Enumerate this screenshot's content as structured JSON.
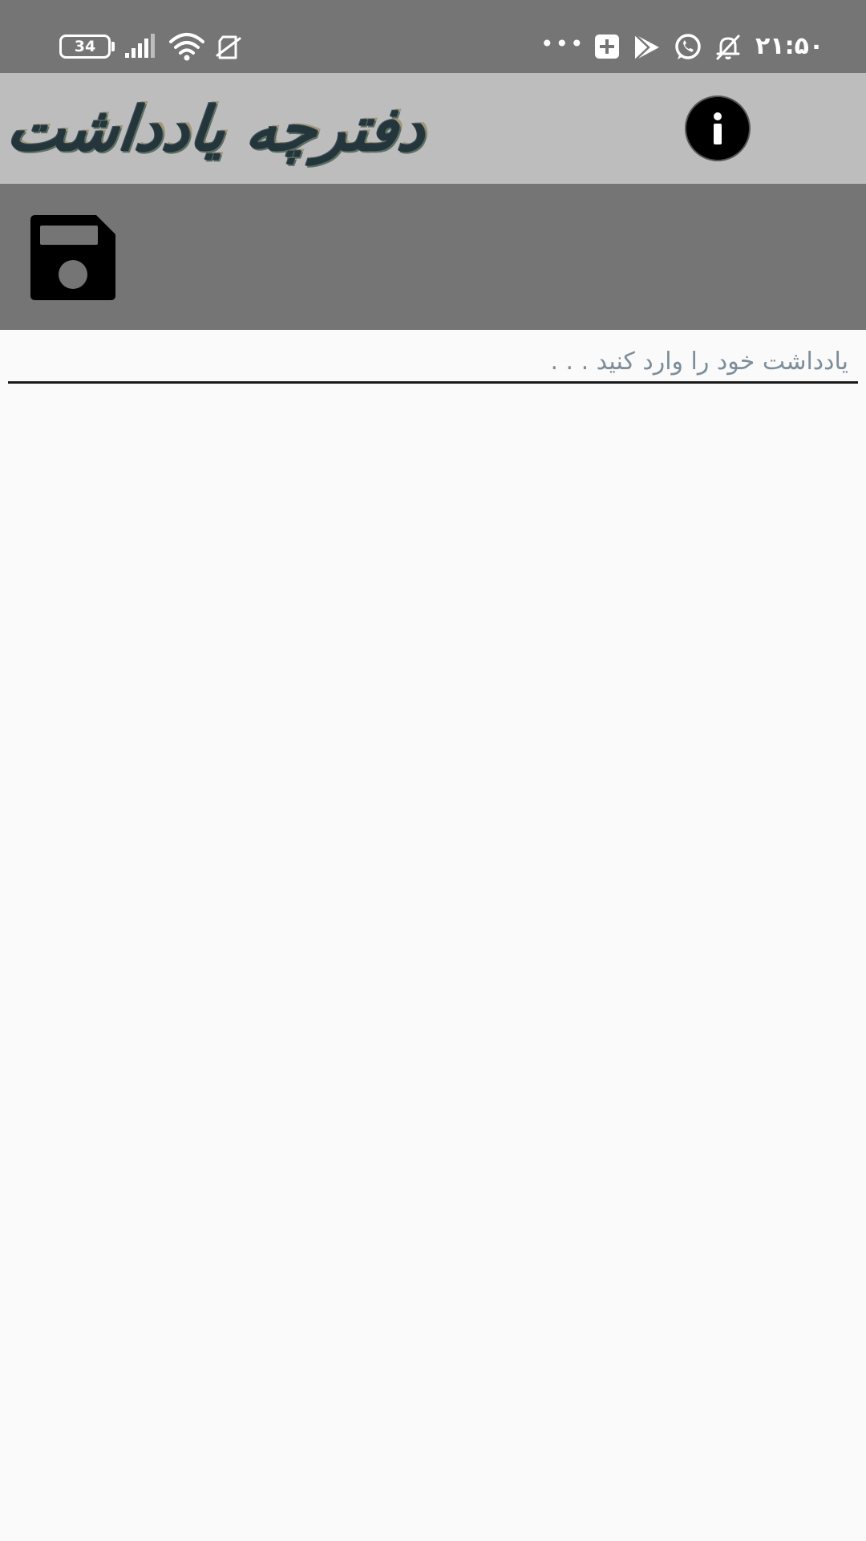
{
  "status_bar": {
    "battery_level": "34",
    "time": "۲۱:۵۰",
    "overflow_dots": "•••",
    "icons": [
      "battery-icon",
      "cell-signal-icon",
      "wifi-icon",
      "no-sim-icon",
      "more-notifications-icon",
      "add-box-icon",
      "play-store-icon",
      "whatsapp-icon",
      "bell-off-icon"
    ]
  },
  "header": {
    "title": "دفترچه یادداشت",
    "info_icon": "info-icon"
  },
  "toolbar": {
    "save_icon": "floppy-disk-icon"
  },
  "note": {
    "placeholder": "یادداشت خود را وارد کنید . . .",
    "value": ""
  },
  "colors": {
    "status_bar_bg": "#757575",
    "header_bg": "#bdbdbd",
    "toolbar_bg": "#757575",
    "content_bg": "#fafafa",
    "placeholder": "#7d8e9a"
  }
}
